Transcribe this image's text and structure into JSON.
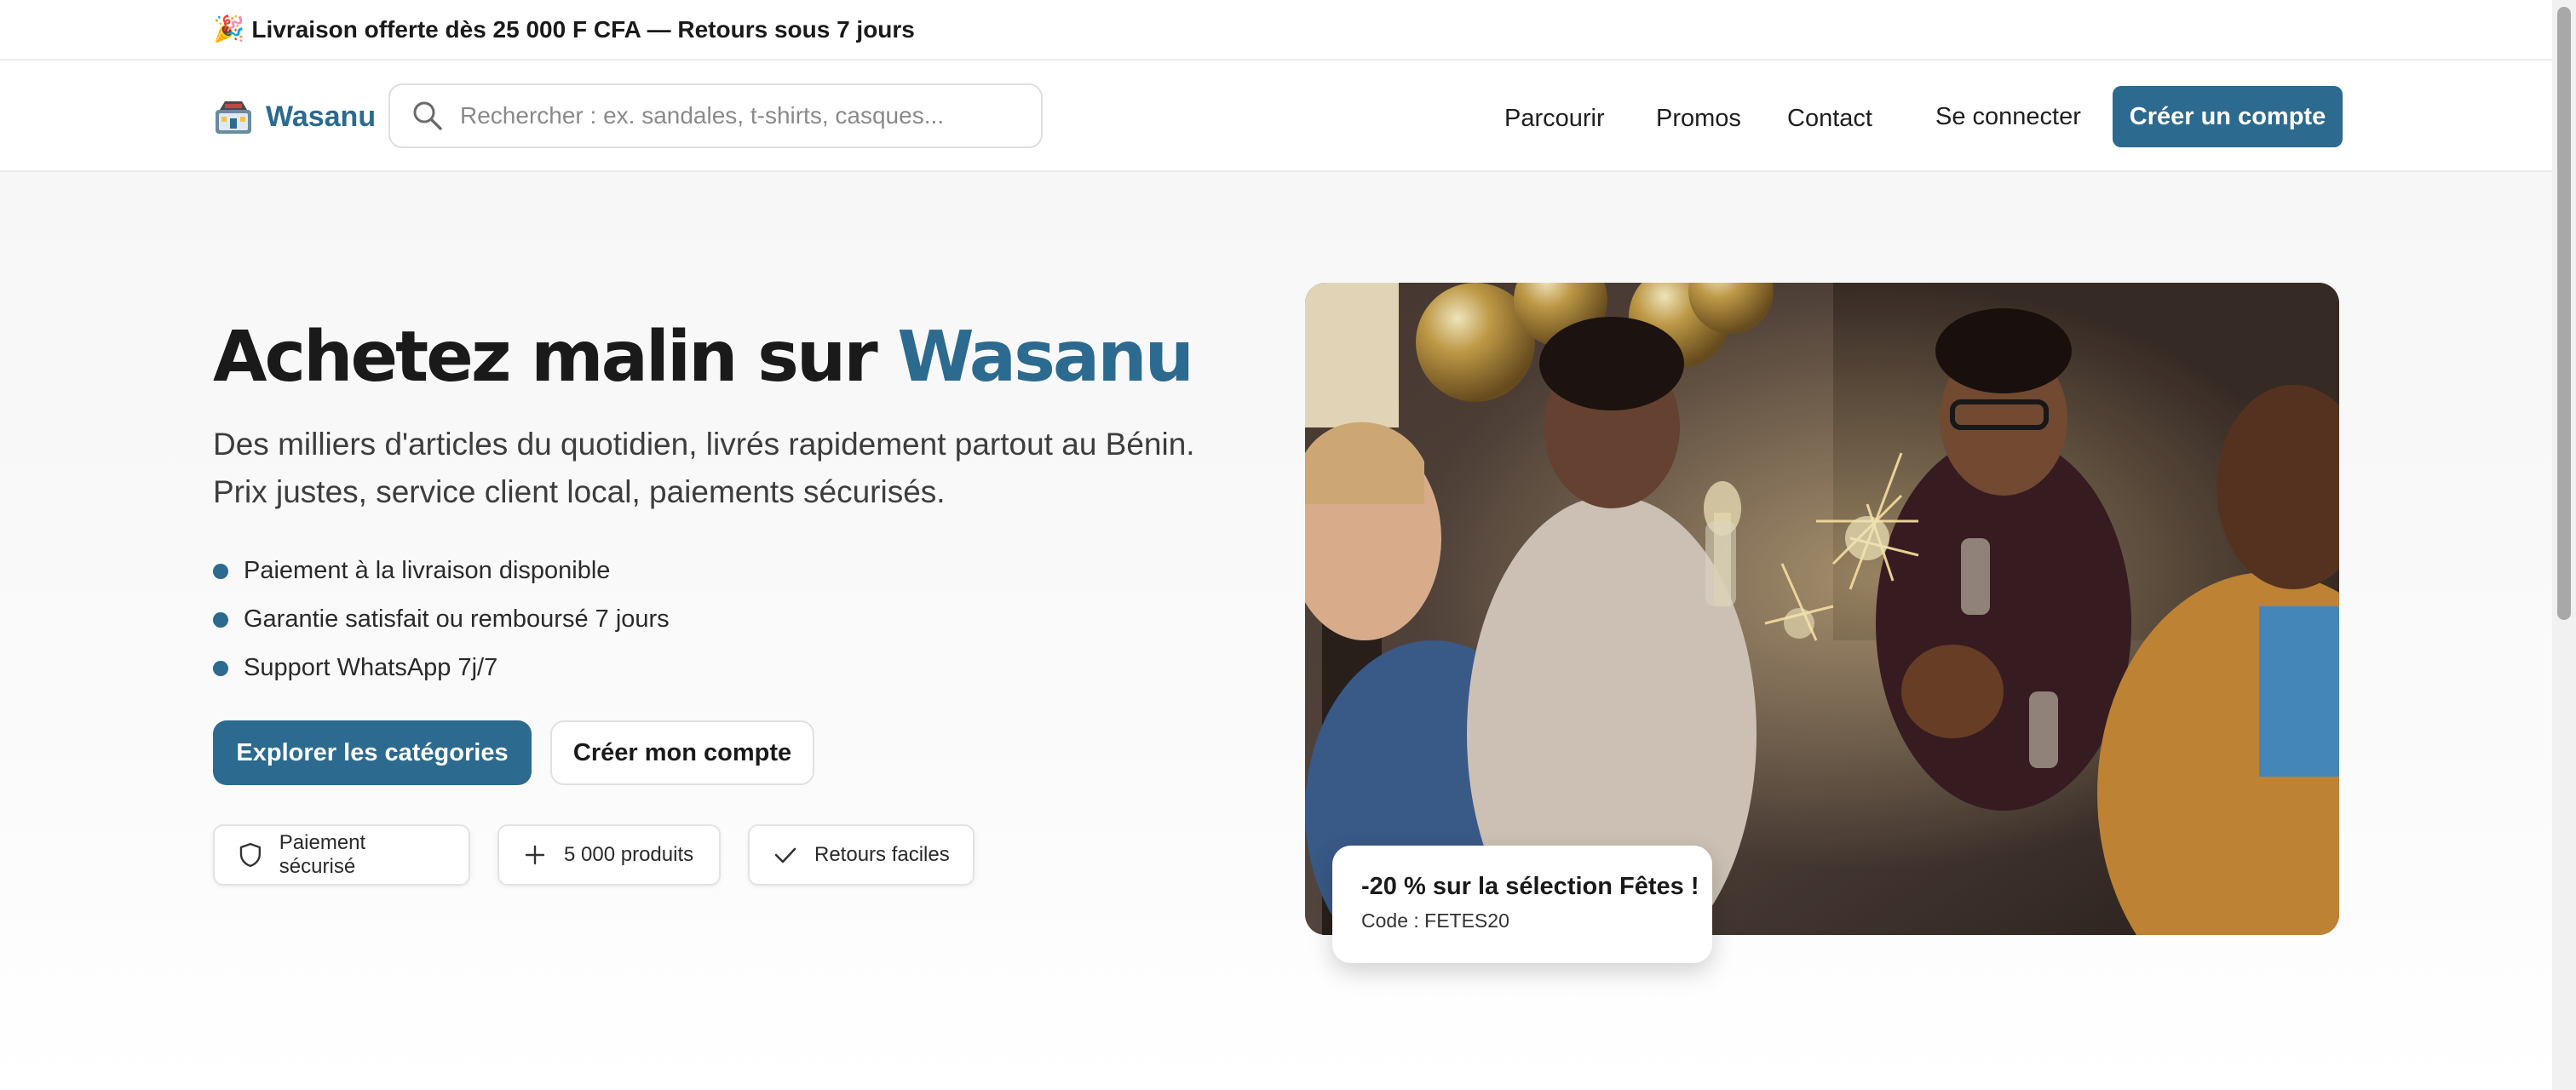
{
  "topbar": {
    "emoji": "🎉",
    "text": "Livraison offerte dès 25 000 F CFA — Retours sous 7 jours"
  },
  "header": {
    "brand": "Wasanu",
    "search_placeholder": "Rechercher : ex. sandales, t-shirts, casques...",
    "nav": [
      "Parcourir",
      "Promos",
      "Contact"
    ],
    "login_label": "Se connecter",
    "signup_label": "Créer un compte"
  },
  "hero": {
    "title_prefix": "Achetez malin sur ",
    "title_brand": "Wasanu",
    "lead_line1": "Des milliers d'articles du quotidien, livrés rapidement partout au Bénin.",
    "lead_line2": "Prix justes, service client local, paiements sécurisés.",
    "features": [
      "Paiement à la livraison disponible",
      "Garantie satisfait ou remboursé 7 jours",
      "Support WhatsApp 7j/7"
    ],
    "primary_cta": "Explorer les catégories",
    "secondary_cta": "Créer mon compte",
    "chips": [
      "Paiement sécurisé",
      "5 000 produits",
      "Retours faciles"
    ]
  },
  "promo": {
    "title": "-20 % sur la sélection Fêtes !",
    "code": "Code : FETES20"
  },
  "colors": {
    "accent": "#2c6a8f",
    "text": "#1a1a1a"
  }
}
